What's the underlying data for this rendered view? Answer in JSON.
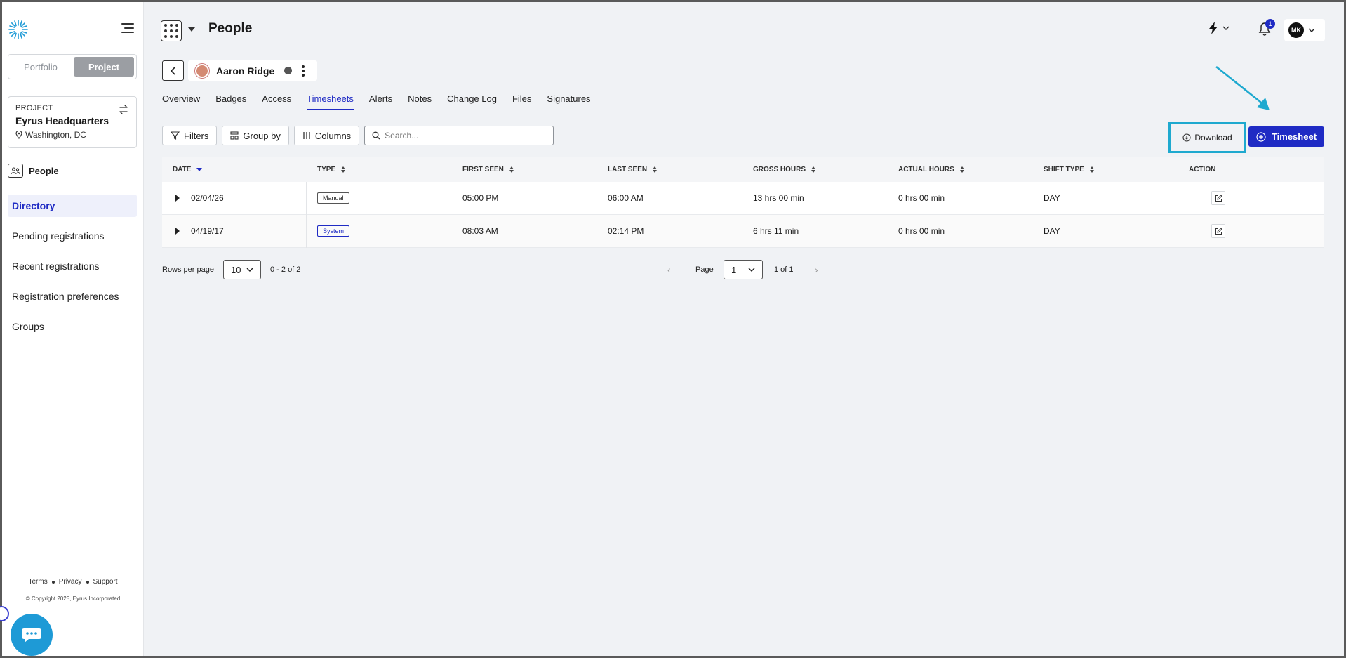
{
  "sidebar": {
    "scope": {
      "portfolio": "Portfolio",
      "project": "Project"
    },
    "project": {
      "label": "PROJECT",
      "name": "Eyrus Headquarters",
      "location": "Washington, DC"
    },
    "section": "People",
    "items": [
      {
        "label": "Directory"
      },
      {
        "label": "Pending registrations"
      },
      {
        "label": "Recent registrations"
      },
      {
        "label": "Registration preferences"
      },
      {
        "label": "Groups"
      }
    ],
    "footer": {
      "terms": "Terms",
      "privacy": "Privacy",
      "support": "Support",
      "copyright": "© Copyright 2025, Eyrus Incorporated"
    }
  },
  "header": {
    "title": "People",
    "notifications_count": "1",
    "user_initials": "MK"
  },
  "person": {
    "name": "Aaron Ridge"
  },
  "tabs": [
    {
      "label": "Overview"
    },
    {
      "label": "Badges"
    },
    {
      "label": "Access"
    },
    {
      "label": "Timesheets"
    },
    {
      "label": "Alerts"
    },
    {
      "label": "Notes"
    },
    {
      "label": "Change Log"
    },
    {
      "label": "Files"
    },
    {
      "label": "Signatures"
    }
  ],
  "toolbar": {
    "filters": "Filters",
    "group_by": "Group by",
    "columns": "Columns",
    "search_placeholder": "Search...",
    "download": "Download",
    "timesheet": "Timesheet"
  },
  "table": {
    "columns": [
      "DATE",
      "TYPE",
      "FIRST SEEN",
      "LAST SEEN",
      "GROSS HOURS",
      "ACTUAL HOURS",
      "SHIFT TYPE",
      "ACTION"
    ],
    "rows": [
      {
        "date": "02/04/26",
        "type": "Manual",
        "first_seen": "05:00 PM",
        "last_seen": "06:00 AM",
        "gross": "13 hrs 00 min",
        "actual": "0 hrs 00 min",
        "shift": "DAY"
      },
      {
        "date": "04/19/17",
        "type": "System",
        "first_seen": "08:03 AM",
        "last_seen": "02:14 PM",
        "gross": "6 hrs 11 min",
        "actual": "0 hrs 00 min",
        "shift": "DAY"
      }
    ]
  },
  "pagination": {
    "rows_per_page_label": "Rows per page",
    "rows_per_page": "10",
    "range": "0 - 2 of 2",
    "page_label": "Page",
    "page": "1",
    "of": "1 of 1"
  },
  "colors": {
    "accent": "#1f2bc4",
    "highlight": "#1ea9cf",
    "chat": "#1e9ad6"
  }
}
